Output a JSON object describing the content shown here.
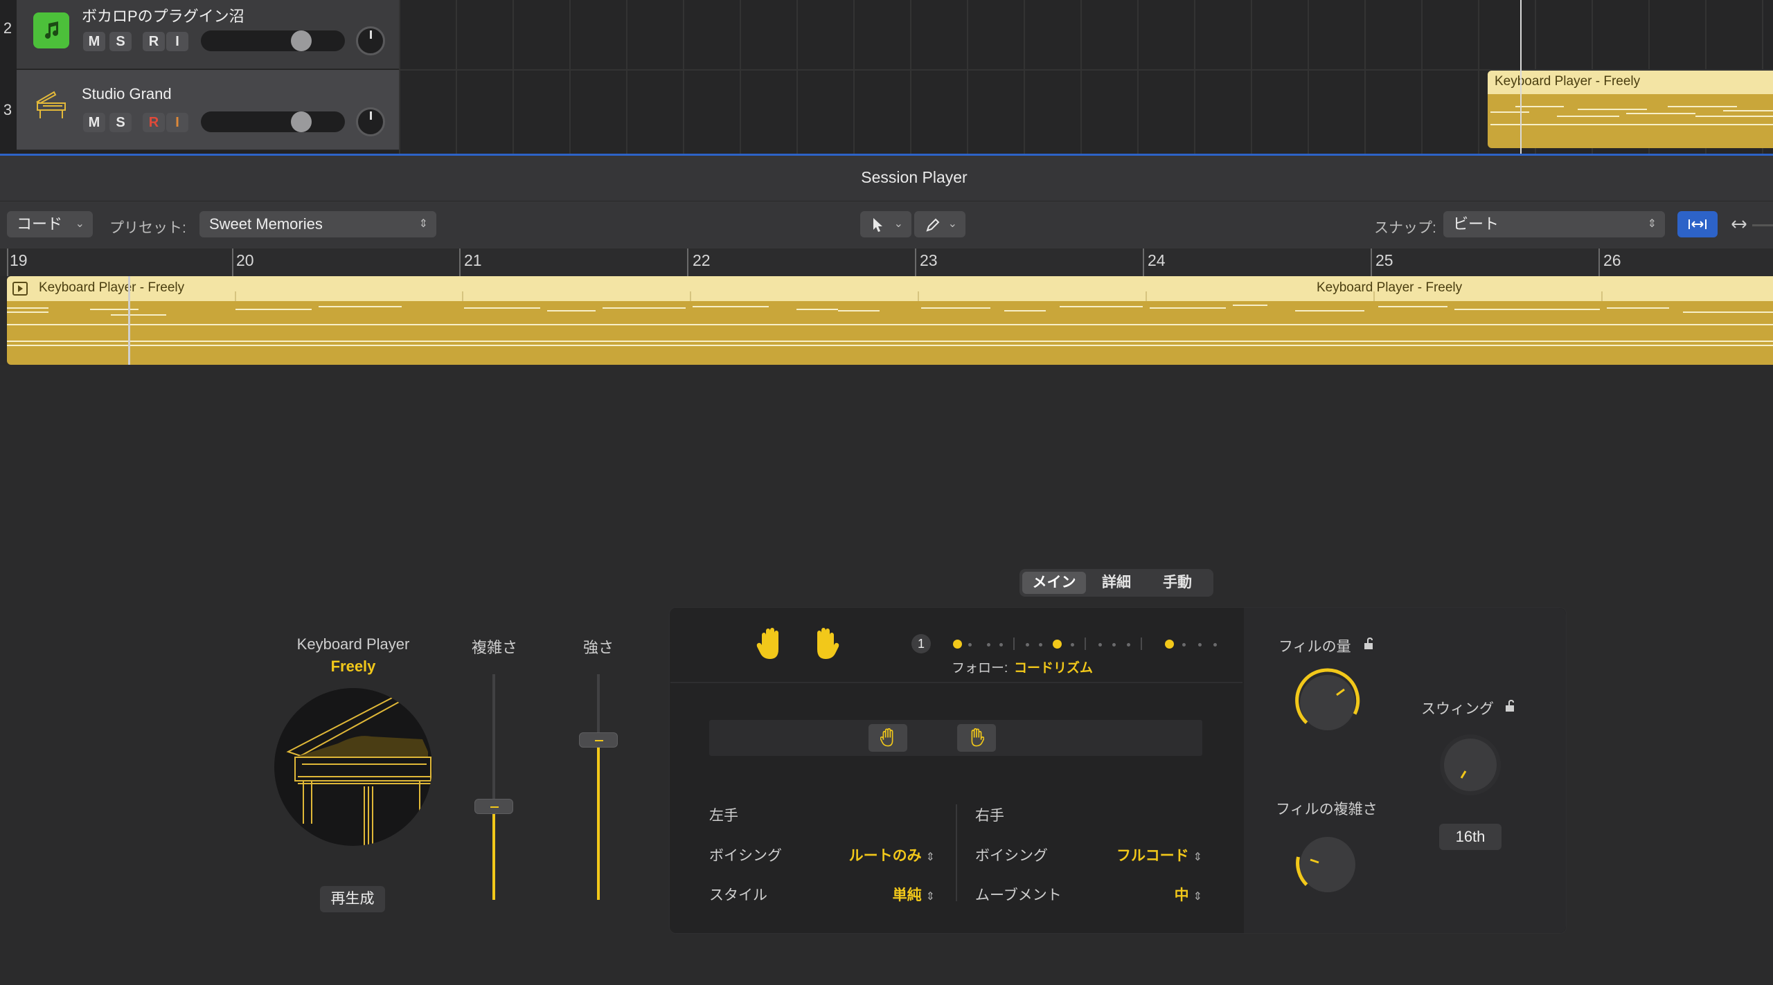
{
  "tracks": [
    {
      "number": "2",
      "name": "ボカロPのプラグイン沼",
      "m": "M",
      "s": "S",
      "r": "R",
      "i": "I",
      "icon": "music-note-icon",
      "icon_color": "#4cc03a"
    },
    {
      "number": "3",
      "name": "Studio Grand",
      "m": "M",
      "s": "S",
      "r": "R",
      "i": "I",
      "icon": "grand-piano-icon"
    }
  ],
  "lane_region_label": "Keyboard Player - Freely",
  "session_player": {
    "title": "Session Player",
    "chord_button": "コード",
    "preset_label": "プリセット:",
    "preset_value": "Sweet Memories",
    "snap_label": "スナップ:",
    "snap_value": "ビート"
  },
  "ruler": {
    "bars": [
      "19",
      "20",
      "21",
      "22",
      "23",
      "24",
      "25",
      "26"
    ]
  },
  "region": {
    "label_1": "Keyboard Player - Freely",
    "label_2": "Keyboard Player - Freely"
  },
  "tabs": {
    "main": "メイン",
    "detail": "詳細",
    "manual": "手動"
  },
  "player": {
    "name": "Keyboard Player",
    "style": "Freely",
    "regen": "再生成"
  },
  "sliders": {
    "complexity_label": "複雑さ",
    "intensity_label": "強さ"
  },
  "follow": {
    "label": "フォロー:",
    "value": "コードリズム",
    "step": "1"
  },
  "left_hand": {
    "title": "左手",
    "voicing_label": "ボイシング",
    "voicing_value": "ルートのみ",
    "style_label": "スタイル",
    "style_value": "単純"
  },
  "right_hand": {
    "title": "右手",
    "voicing_label": "ボイシング",
    "voicing_value": "フルコード",
    "movement_label": "ムーブメント",
    "movement_value": "中"
  },
  "fill": {
    "amount_label": "フィルの量",
    "complexity_label": "フィルの複雑さ"
  },
  "swing": {
    "label": "スウィング",
    "value": "16th"
  },
  "colors": {
    "accent": "#f2c81a",
    "region": "#c9a63a",
    "region_header": "#f3e4a4",
    "selection_blue": "#2d63c8"
  }
}
